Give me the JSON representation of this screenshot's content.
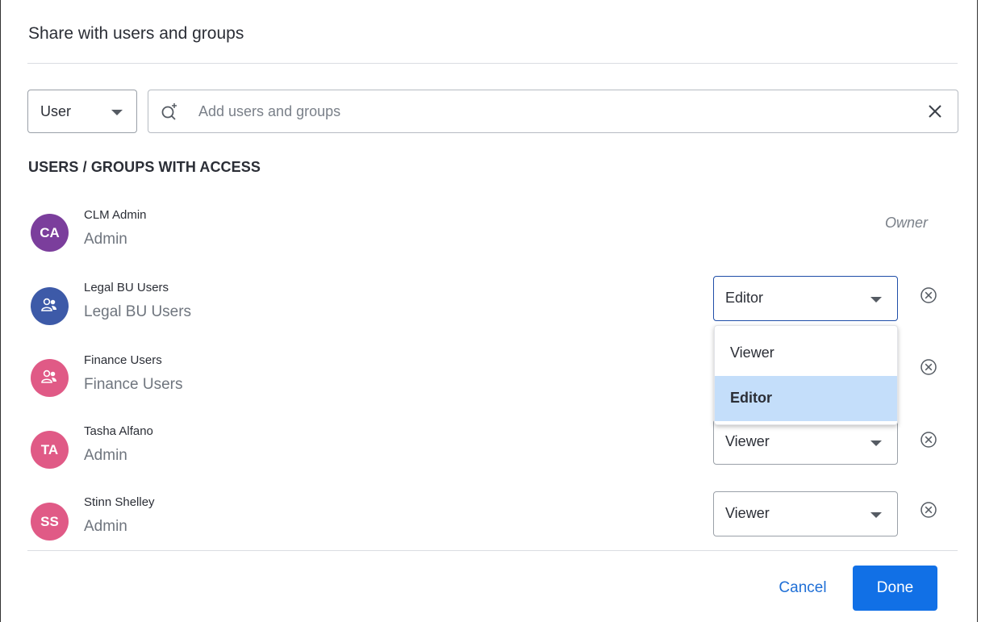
{
  "dialog": {
    "title": "Share with users and groups"
  },
  "filter": {
    "type_value": "User",
    "search_placeholder": "Add users and groups"
  },
  "access": {
    "heading": "USERS / GROUPS WITH ACCESS",
    "entries": [
      {
        "initials": "CA",
        "name": "CLM Admin",
        "subtitle": "Admin",
        "role": "Owner",
        "avatar_color": "#7b3e9c",
        "kind": "user"
      },
      {
        "initials": "",
        "name": "Legal BU Users",
        "subtitle": "Legal BU Users",
        "role": "Editor",
        "avatar_color": "#3d5aa8",
        "kind": "group"
      },
      {
        "initials": "",
        "name": "Finance Users",
        "subtitle": "Finance Users",
        "role": "Editor",
        "avatar_color": "#e05a86",
        "kind": "group"
      },
      {
        "initials": "TA",
        "name": "Tasha Alfano",
        "subtitle": "Admin",
        "role": "Viewer",
        "avatar_color": "#e05a86",
        "kind": "user"
      },
      {
        "initials": "SS",
        "name": "Stinn Shelley",
        "subtitle": "Admin",
        "role": "Viewer",
        "avatar_color": "#e05a86",
        "kind": "user"
      }
    ]
  },
  "role_menu": {
    "options": [
      "Viewer",
      "Editor"
    ],
    "selected": "Editor"
  },
  "footer": {
    "cancel_label": "Cancel",
    "done_label": "Done"
  },
  "colors": {
    "primary": "#1170e6",
    "menu_highlight": "#c4defa",
    "link": "#1f6fd6"
  },
  "icons": [
    "search-add-icon",
    "close-icon",
    "chevron-down-icon",
    "group-icon",
    "remove-circle-icon"
  ]
}
